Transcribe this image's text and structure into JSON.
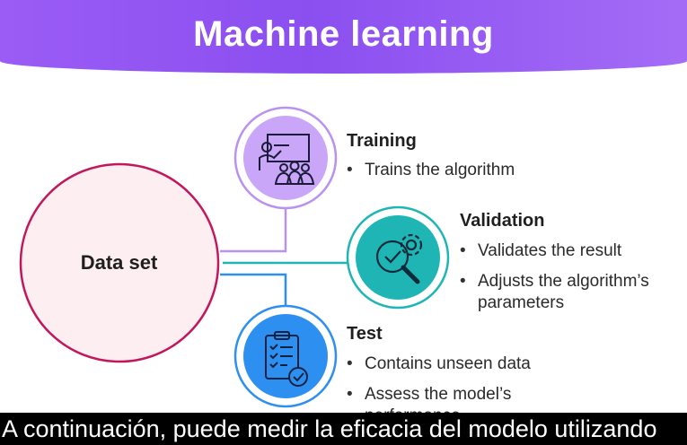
{
  "header": {
    "title": "Machine learning"
  },
  "dataset": {
    "label": "Data set"
  },
  "stages": {
    "training": {
      "title": "Training",
      "bullets": [
        "Trains the algorithm"
      ],
      "color": "#c9a6f7"
    },
    "validation": {
      "title": "Validation",
      "bullets": [
        "Validates the result",
        "Adjusts the algorithm’s parameters"
      ],
      "color": "#1fb5b5"
    },
    "test": {
      "title": "Test",
      "bullets": [
        "Contains unseen data",
        "Assess the model’s performance"
      ],
      "color": "#2d8ff0"
    }
  },
  "caption": {
    "text": "A continuación, puede medir la eficacia del modelo utilizando"
  },
  "icons": {
    "training": "presentation-icon",
    "validation": "magnifier-check-gear-icon",
    "test": "clipboard-checklist-icon"
  }
}
